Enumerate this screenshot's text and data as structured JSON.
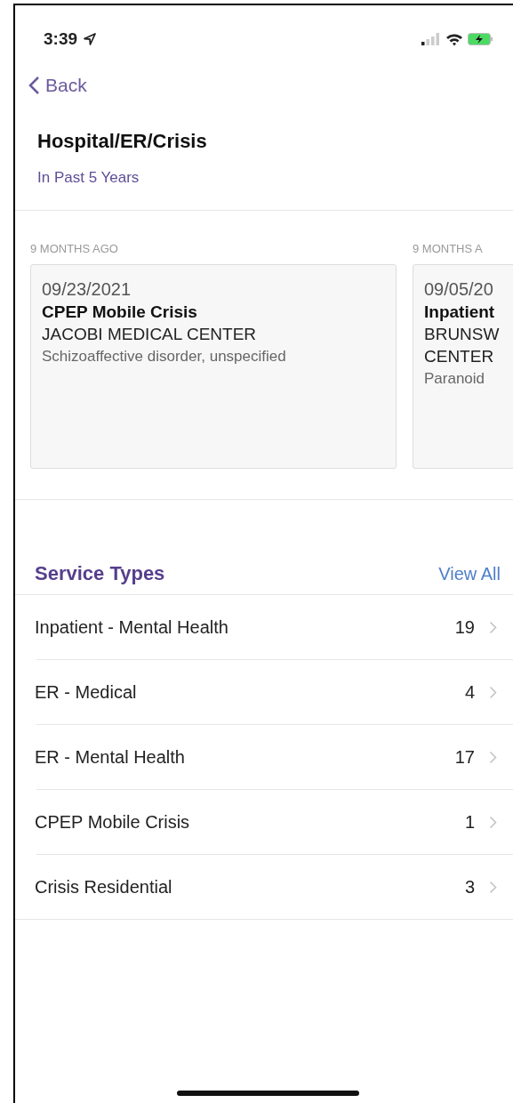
{
  "status_bar": {
    "time": "3:39"
  },
  "nav": {
    "back": "Back"
  },
  "header": {
    "title": "Hospital/ER/Crisis",
    "subtitle": "In Past 5 Years"
  },
  "visits": [
    {
      "ago": "9 MONTHS AGO",
      "date": "09/23/2021",
      "service": "CPEP Mobile Crisis",
      "facility": "JACOBI MEDICAL CENTER",
      "diagnosis": "Schizoaffective disorder, unspecified"
    },
    {
      "ago": "9 MONTHS A",
      "date": "09/05/20",
      "service": "Inpatient",
      "facility": "BRUNSW",
      "facility_2": "CENTER",
      "diagnosis": "Paranoid"
    }
  ],
  "service_types": {
    "title": "Service Types",
    "view_all": "View All",
    "rows": [
      {
        "label": "Inpatient - Mental Health",
        "count": "19"
      },
      {
        "label": "ER - Medical",
        "count": "4"
      },
      {
        "label": "ER - Mental Health",
        "count": "17"
      },
      {
        "label": "CPEP Mobile Crisis",
        "count": "1"
      },
      {
        "label": "Crisis Residential",
        "count": "3"
      }
    ]
  }
}
